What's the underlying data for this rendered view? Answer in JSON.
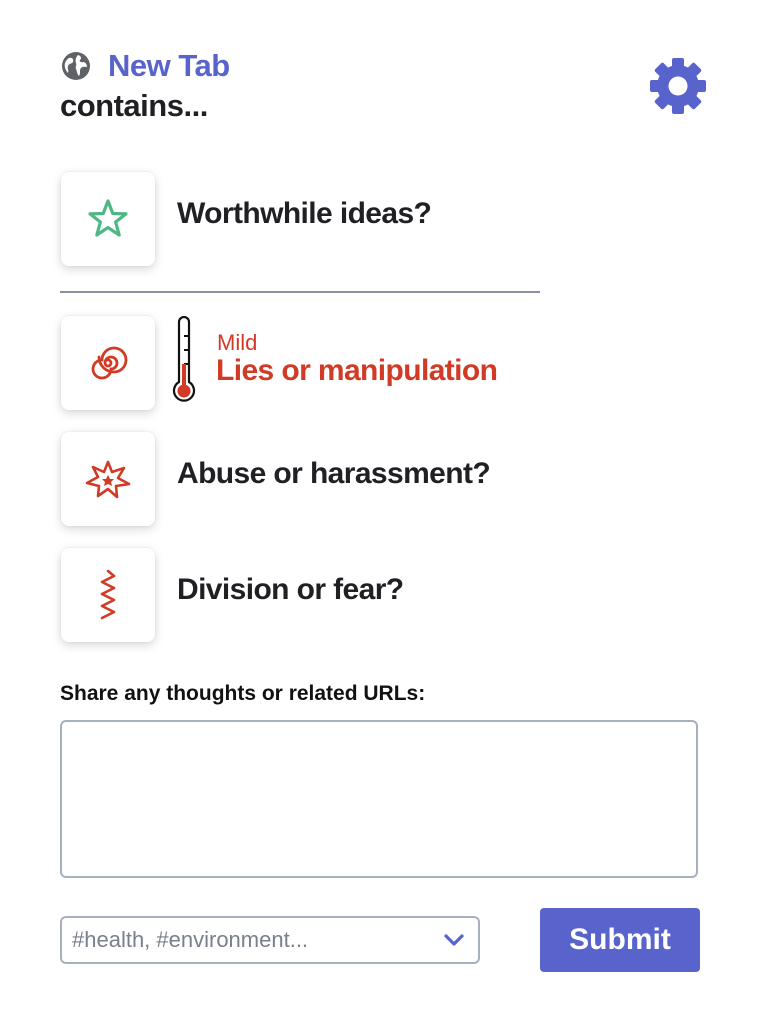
{
  "header": {
    "tab_title": "New Tab",
    "contains_label": "contains..."
  },
  "icons": {
    "globe": "globe-icon",
    "settings": "gear-icon",
    "worthwhile": "star-icon",
    "lies": "spiral-icon",
    "abuse": "burst-icon",
    "division": "zigzag-icon",
    "severity": "thermometer-icon",
    "dropdown": "chevron-down-icon"
  },
  "questions": {
    "worthwhile": "Worthwhile ideas?",
    "lies_severity": "Mild",
    "lies": "Lies or manipulation",
    "abuse": "Abuse or harassment?",
    "division": "Division or fear?"
  },
  "form": {
    "share_label": "Share any thoughts or related URLs:",
    "thoughts_value": "",
    "tags_placeholder": "#health, #environment...",
    "submit_label": "Submit"
  },
  "colors": {
    "accent": "#5864cc",
    "star": "#4db886",
    "danger": "#d13b26",
    "text": "#1f1f24"
  }
}
